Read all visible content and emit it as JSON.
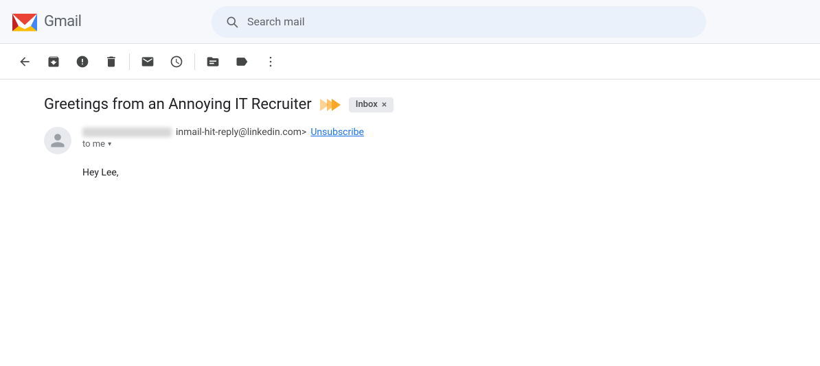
{
  "header": {
    "logo_text": "Gmail",
    "search_placeholder": "Search mail"
  },
  "toolbar": {
    "back_label": "←",
    "archive_label": "Archive",
    "report_label": "Report spam",
    "delete_label": "Delete",
    "mark_unread_label": "Mark as unread",
    "snooze_label": "Snooze",
    "move_label": "Move to",
    "label_label": "Label",
    "more_label": "More"
  },
  "email": {
    "subject": "Greetings from an Annoying IT Recruiter",
    "inbox_badge": "Inbox",
    "inbox_badge_close": "×",
    "sender_email_partial": "inmail-hit-reply@linkedin.com>",
    "unsubscribe_text": "Unsubscribe",
    "to_me_label": "to me",
    "body_greeting": "Hey Lee,"
  },
  "icons": {
    "search": "🔍",
    "back": "←",
    "archive": "⬇",
    "spam": "⚠",
    "delete": "🗑",
    "mark_unread": "✉",
    "snooze": "🕐",
    "move": "➡",
    "label": "🏷",
    "more": "⋮",
    "person": "👤",
    "dropdown": "▾"
  }
}
